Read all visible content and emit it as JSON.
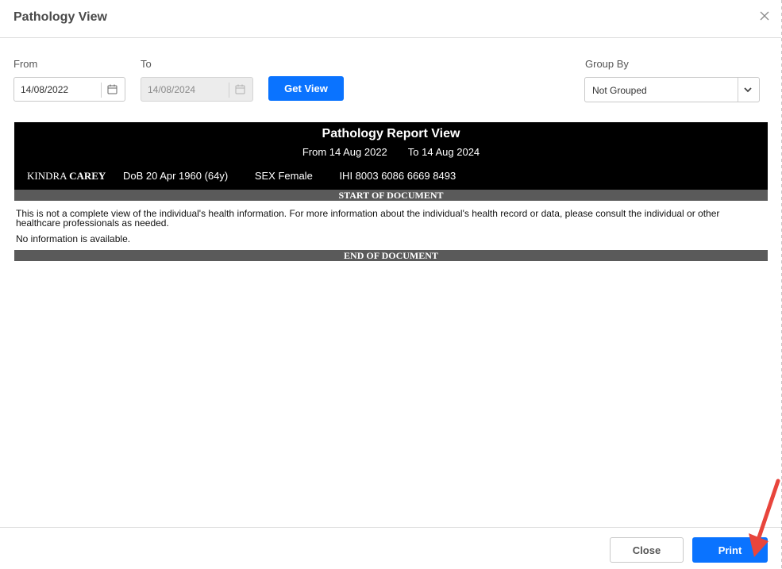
{
  "dialog": {
    "title": "Pathology View",
    "close_icon": "close-icon"
  },
  "filters": {
    "from_label": "From",
    "from_value": "14/08/2022",
    "to_label": "To",
    "to_value": "14/08/2024",
    "get_view_label": "Get View",
    "group_by_label": "Group By",
    "group_by_value": "Not Grouped",
    "calendar_icon": "calendar-icon",
    "dropdown_icon": "chevron-down-icon"
  },
  "report": {
    "title": "Pathology Report View",
    "from_text": "From 14 Aug 2022",
    "to_text": "To 14 Aug 2024",
    "patient_first": "KINDRA",
    "patient_last": "CAREY",
    "dob": "DoB 20 Apr 1960 (64y)",
    "sex": "SEX Female",
    "ihi": "IHI 8003 6086 6669 8493",
    "start_marker": "START OF DOCUMENT",
    "disclaimer": "This is not a complete view of the individual's health information. For more information about the individual's health record or data, please consult the individual or other healthcare professionals as needed.",
    "no_info": "No information is available.",
    "end_marker": "END OF DOCUMENT"
  },
  "footer": {
    "close_label": "Close",
    "print_label": "Print"
  },
  "colors": {
    "primary": "#0a73ff",
    "report_header_bg": "#000000",
    "band_bg": "#5a5a5a",
    "annotation_arrow": "#e8453c"
  }
}
